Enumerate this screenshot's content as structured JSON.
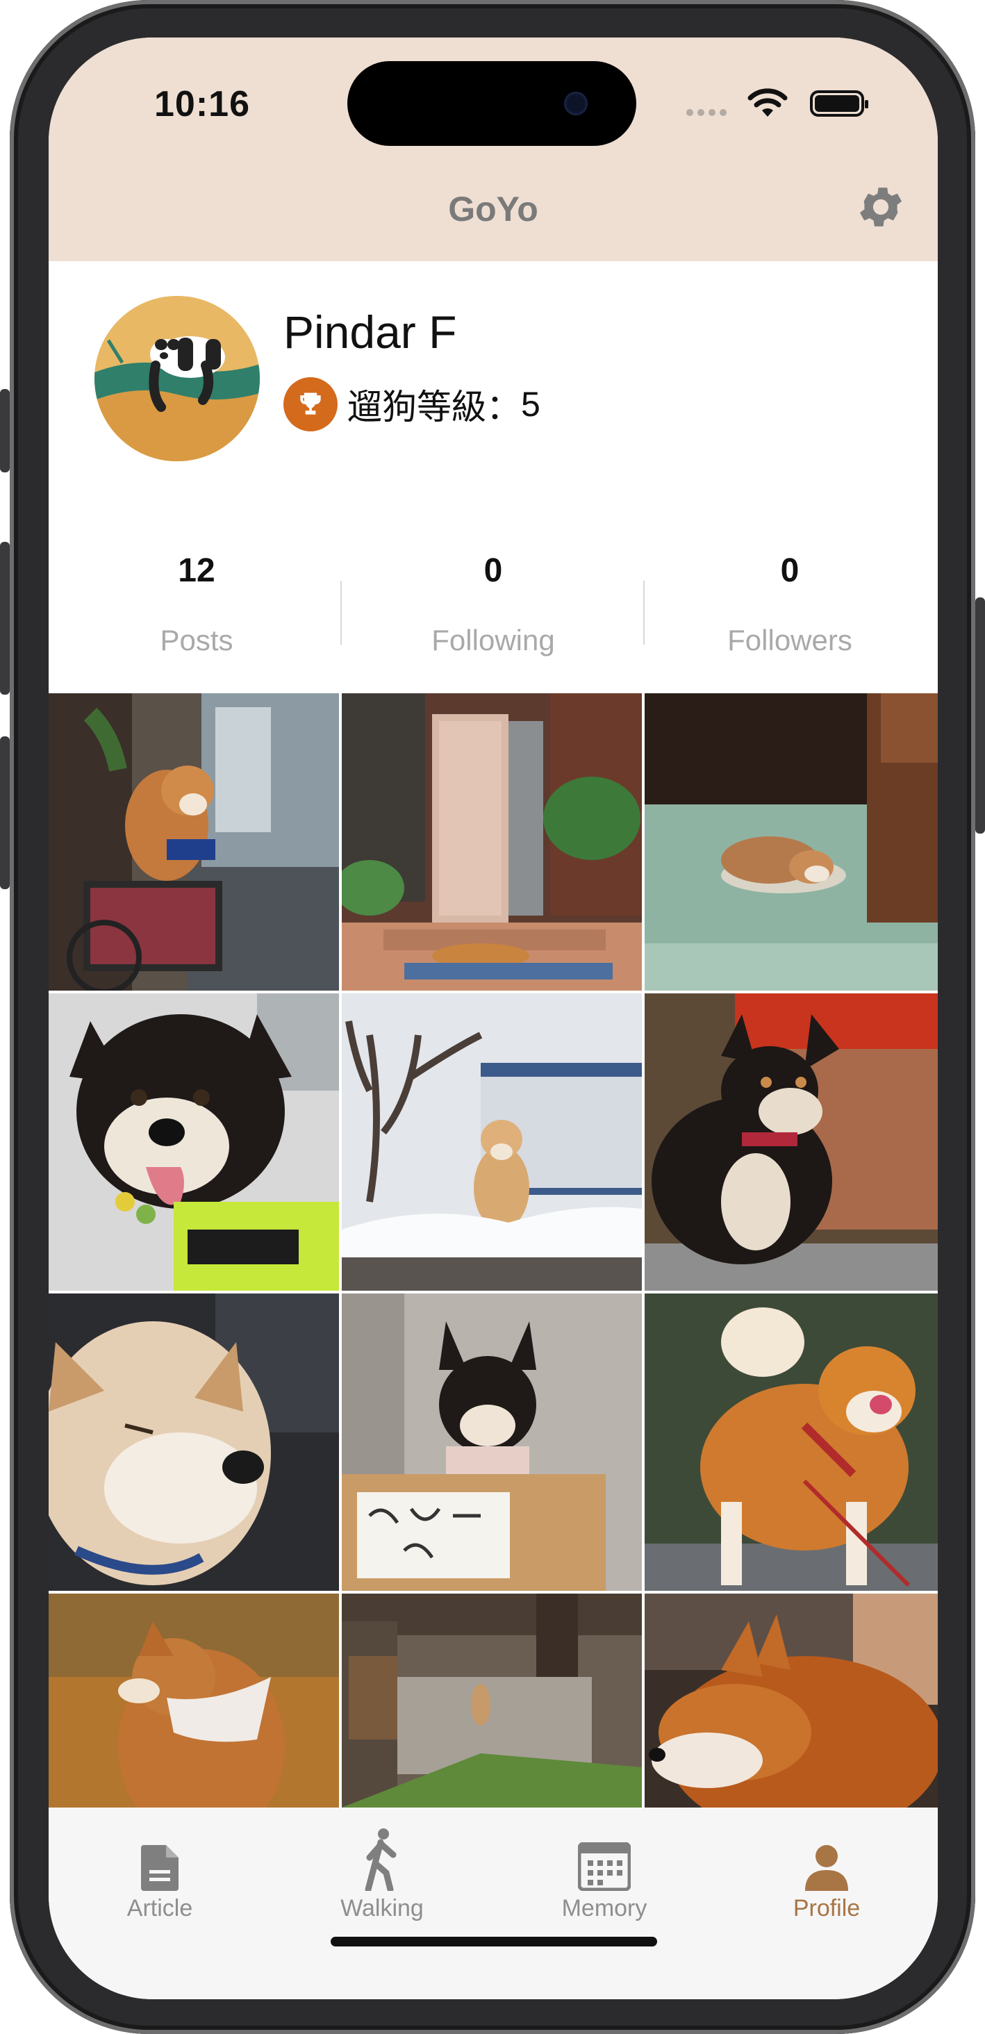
{
  "status_bar": {
    "time": "10:16"
  },
  "app": {
    "title": "GoYo",
    "settings_icon": "gear-icon"
  },
  "profile": {
    "username": "Pindar F",
    "level_label": "遛狗等級：",
    "level_value": "5",
    "trophy_icon": "trophy-icon",
    "stats": [
      {
        "value": "12",
        "label": "Posts"
      },
      {
        "value": "0",
        "label": "Following"
      },
      {
        "value": "0",
        "label": "Followers"
      }
    ]
  },
  "grid": {
    "photos": [
      {
        "icon": "shiba-in-bicycle-basket-photo"
      },
      {
        "icon": "dog-sleeping-at-doorstep-photo"
      },
      {
        "icon": "dog-sleeping-on-floor-photo"
      },
      {
        "icon": "black-shiba-with-harness-photo"
      },
      {
        "icon": "shiba-in-snow-photo"
      },
      {
        "icon": "black-shiba-portrait-photo"
      },
      {
        "icon": "cream-shiba-closeup-photo"
      },
      {
        "icon": "shiba-in-box-with-sign-photo"
      },
      {
        "icon": "red-shiba-licking-photo"
      },
      {
        "icon": "shiba-with-scarf-photo"
      },
      {
        "icon": "dog-in-courtyard-photo"
      },
      {
        "icon": "shiba-profile-photo"
      }
    ]
  },
  "tabbar": {
    "tabs": [
      {
        "label": "Article",
        "icon": "document-icon",
        "active": false
      },
      {
        "label": "Walking",
        "icon": "walking-icon",
        "active": false
      },
      {
        "label": "Memory",
        "icon": "calendar-icon",
        "active": false
      },
      {
        "label": "Profile",
        "icon": "person-icon",
        "active": true
      }
    ]
  },
  "colors": {
    "topbar": "#efdfd2",
    "accent": "#a87545",
    "trophy": "#d46a1c",
    "muted_text": "#a9a9a9"
  }
}
